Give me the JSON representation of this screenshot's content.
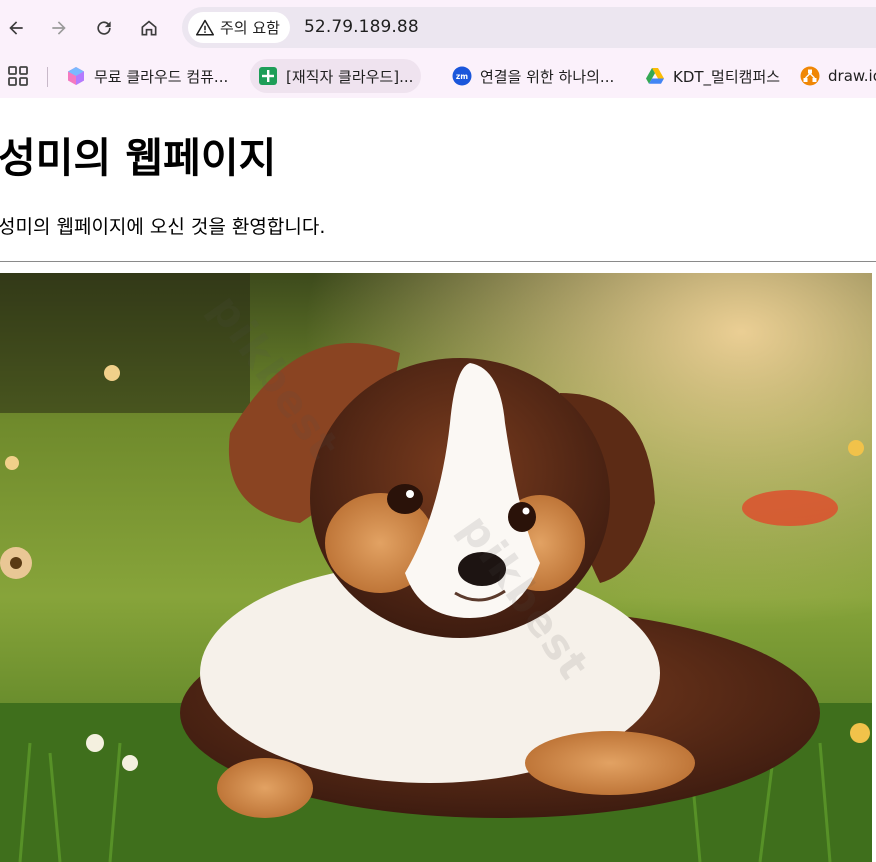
{
  "browser": {
    "security_chip_label": "주의 요함",
    "url": "52.79.189.88"
  },
  "bookmarks": [
    {
      "label": "무료 클라우드 컴퓨...",
      "icon": "cube-icon"
    },
    {
      "label": "[재직자 클라우드]...",
      "icon": "sheets-icon"
    },
    {
      "label": "연결을 위한 하나의...",
      "icon": "zoom-icon"
    },
    {
      "label": "KDT_멀티캠퍼스",
      "icon": "drive-icon"
    },
    {
      "label": "draw.io",
      "icon": "drawio-icon"
    }
  ],
  "page": {
    "heading": "성미의 웹페이지",
    "description": "성미의 웹페이지에 오신 것을 환영합니다."
  },
  "colors": {
    "chrome_bg": "#fbf1fb",
    "omnibox_bg": "#ece6f0"
  }
}
